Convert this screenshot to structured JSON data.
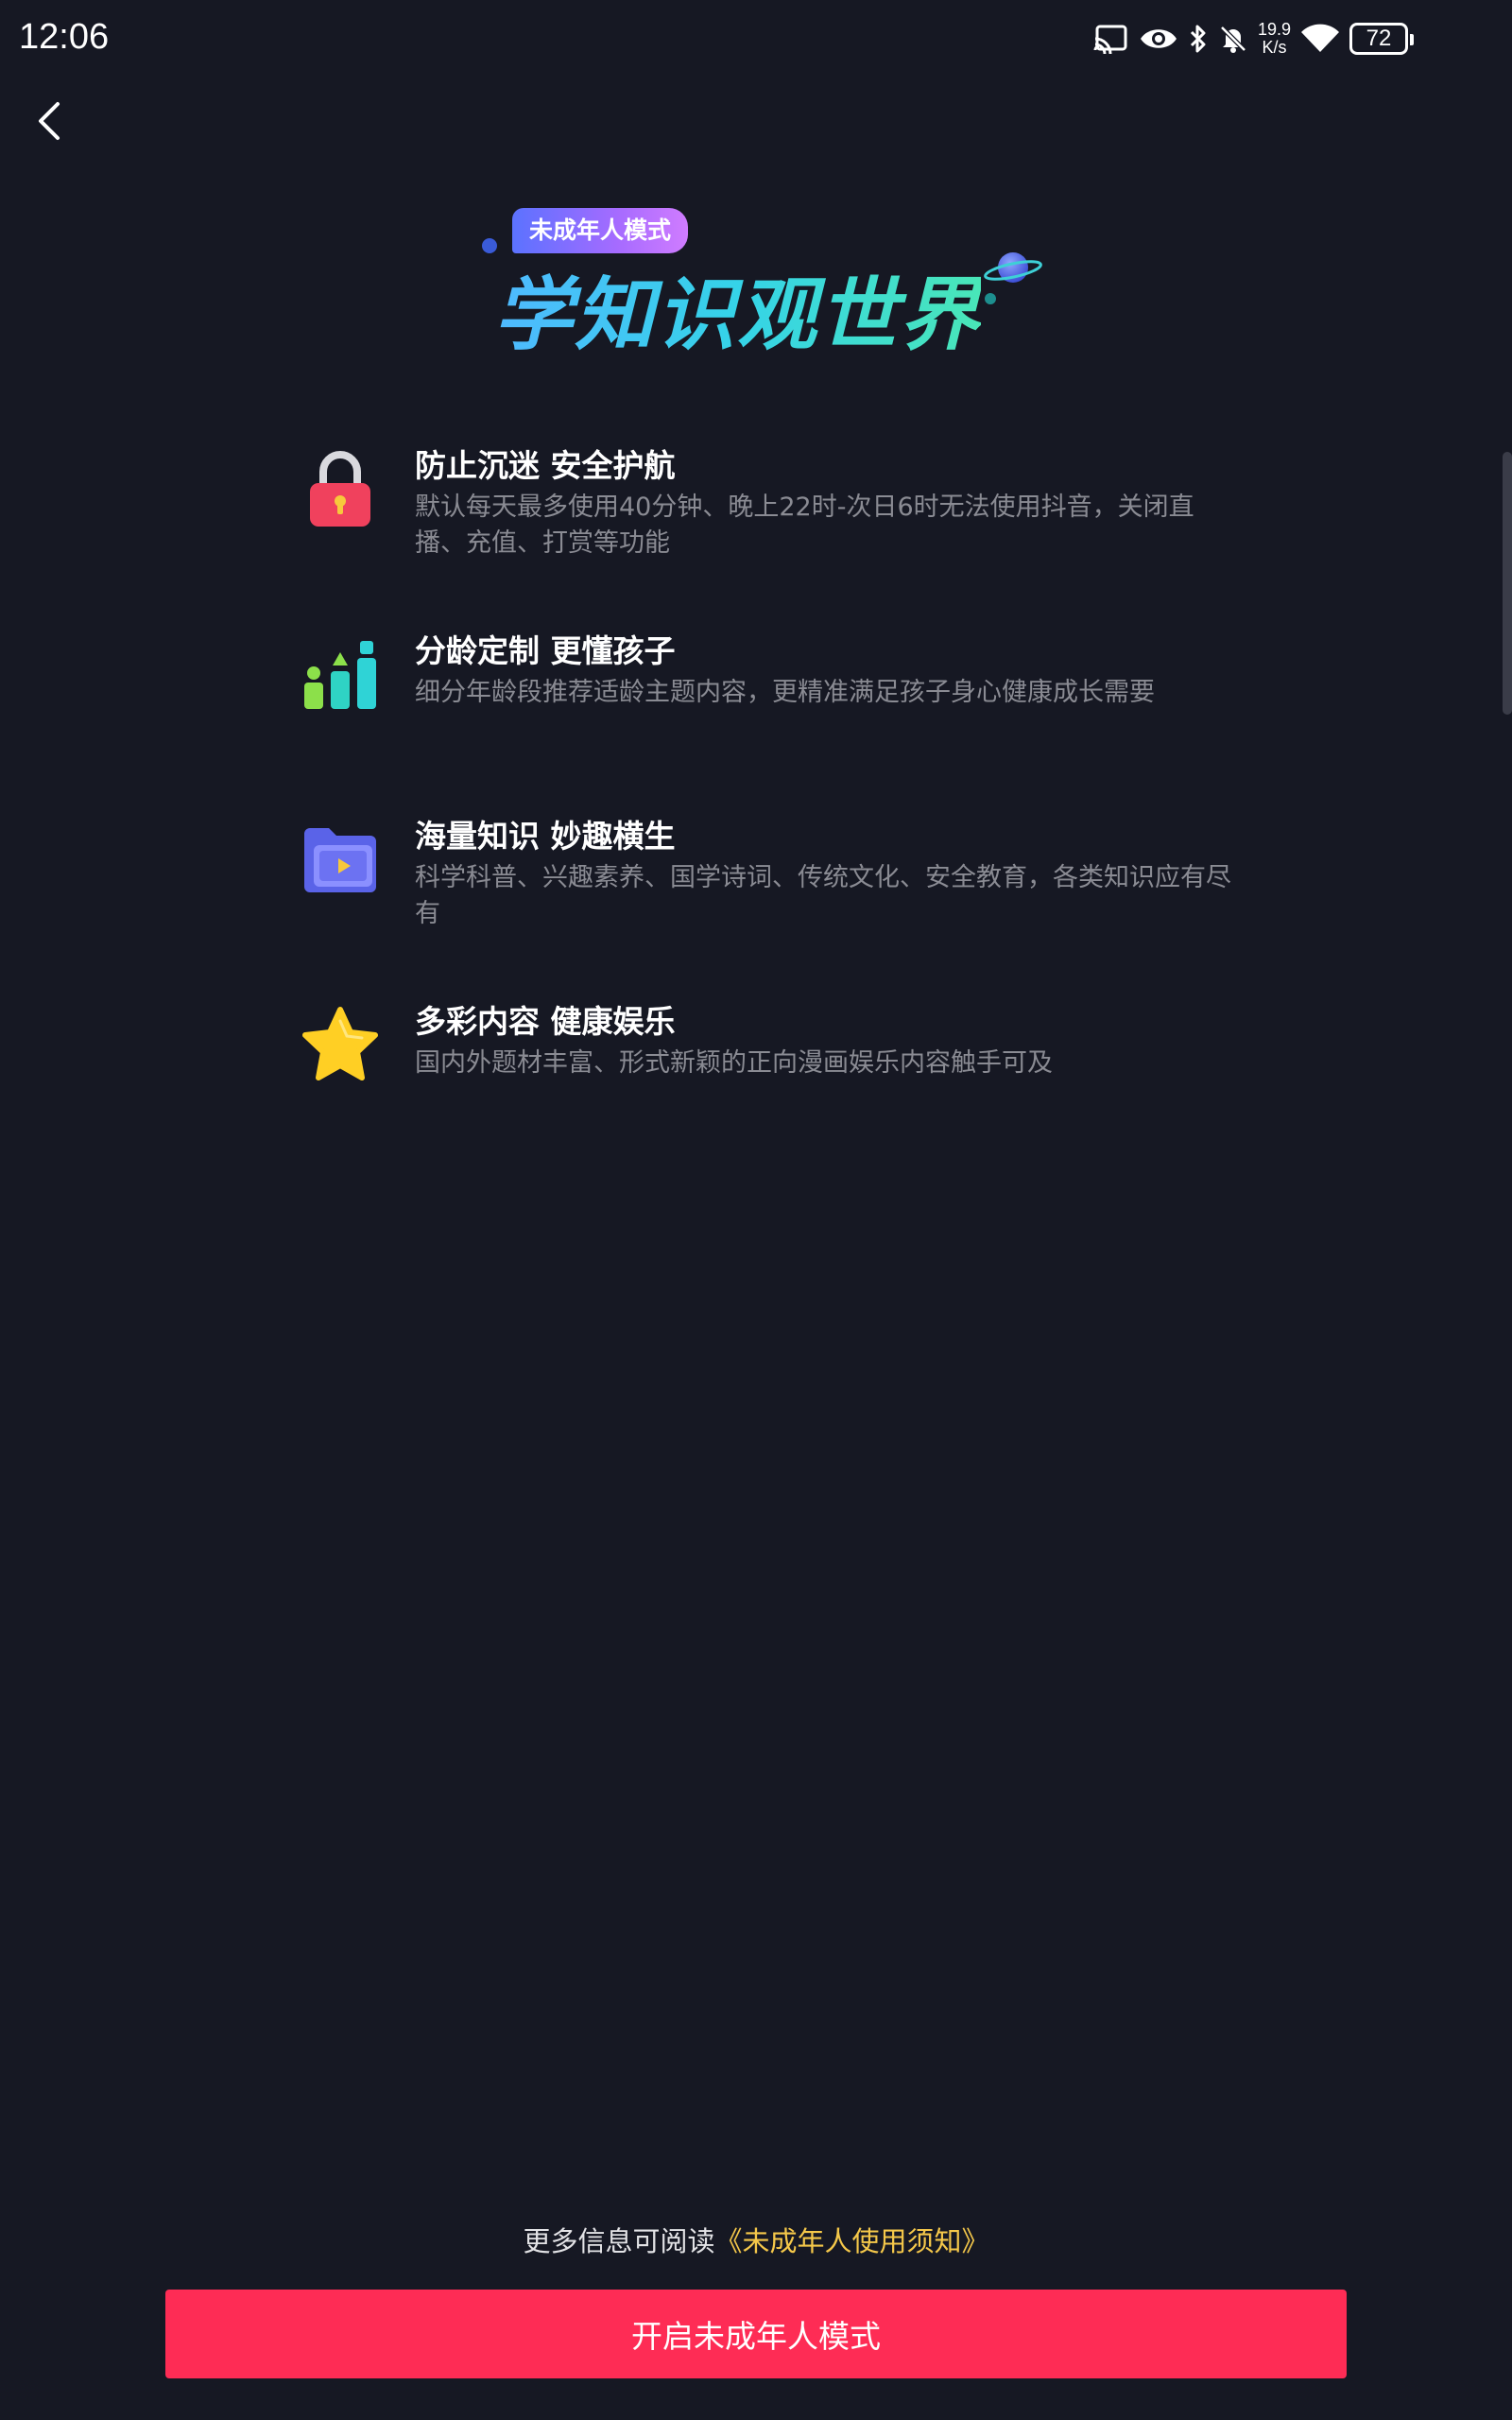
{
  "status_bar": {
    "time": "12:06",
    "net_speed_value": "19.9",
    "net_speed_unit": "K/s",
    "battery_level": "72",
    "icons": [
      "cast-icon",
      "eye-icon",
      "bluetooth-icon",
      "bell-muted-icon",
      "wifi-icon",
      "battery-icon"
    ]
  },
  "nav": {
    "back_icon": "chevron-left-icon"
  },
  "hero": {
    "badge": "未成年人模式",
    "title": "学知识观世界"
  },
  "features": [
    {
      "icon": "lock-icon",
      "title": "防止沉迷 安全护航",
      "description": "默认每天最多使用40分钟、晚上22时-次日6时无法使用抖音，关闭直播、充值、打赏等功能"
    },
    {
      "icon": "bar-chart-icon",
      "title": "分龄定制 更懂孩子",
      "description": "细分年龄段推荐适龄主题内容，更精准满足孩子身心健康成长需要"
    },
    {
      "icon": "video-folder-icon",
      "title": "海量知识 妙趣横生",
      "description": "科学科普、兴趣素养、国学诗词、传统文化、安全教育，各类知识应有尽有"
    },
    {
      "icon": "star-icon",
      "title": "多彩内容 健康娱乐",
      "description": "国内外题材丰富、形式新颖的正向漫画娱乐内容触手可及"
    }
  ],
  "footer": {
    "notice_prefix": "更多信息可阅读",
    "notice_link": "《未成年人使用须知》",
    "button_label": "开启未成年人模式"
  },
  "colors": {
    "background": "#161823",
    "accent_button": "#fe2c55",
    "link": "#f5c84a",
    "secondary_text": "#8a8b93"
  }
}
